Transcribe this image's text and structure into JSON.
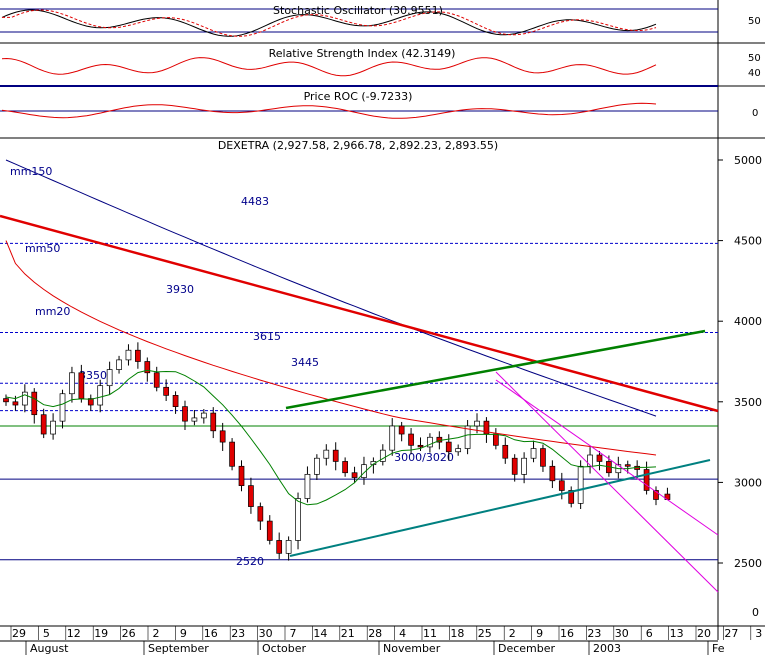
{
  "chart_data": {
    "type": "candlestick",
    "title": "DEXETRA (2,927.58, 2,966.78, 2,892.23, 2,893.55)",
    "colors": {
      "bull": "#ffffff",
      "bear": "#e00000",
      "mm20": "#008000",
      "mm50": "#e00000",
      "mm150": "#000080",
      "levels": "#0000cc",
      "downtrend": "#e00000",
      "uptrend": "#008000",
      "support": "#008080",
      "channel": "#e000e0"
    },
    "panels": [
      {
        "id": "stochastic",
        "label": "Stochastic Oscillator (30.9551)",
        "yticks": [
          "50"
        ],
        "ylim": [
          0,
          100
        ]
      },
      {
        "id": "rsi",
        "label": "Relative Strength Index (42.3149)",
        "yticks": [
          "50",
          "40"
        ],
        "ylim": [
          25,
          75
        ]
      },
      {
        "id": "roc",
        "label": "Price ROC (-9.7233)",
        "yticks": [
          "0"
        ],
        "ylim": [
          -30,
          30
        ]
      }
    ],
    "price_axis": {
      "ylim": [
        2450,
        5200
      ],
      "ticks": [
        "5000",
        "4500",
        "4000",
        "3500",
        "3000",
        "2500",
        "0"
      ],
      "grid": false
    },
    "x_ticks": [
      "29",
      "5",
      "12",
      "19",
      "26",
      "2",
      "9",
      "16",
      "23",
      "30",
      "7",
      "14",
      "21",
      "28",
      "4",
      "11",
      "18",
      "25",
      "2",
      "9",
      "16",
      "23",
      "30",
      "6",
      "13",
      "20",
      "27",
      "3"
    ],
    "months": [
      "August",
      "September",
      "October",
      "November",
      "December",
      "2003",
      "Fe"
    ],
    "levels": [
      {
        "label": "4483",
        "value": 4483,
        "style": "dashed"
      },
      {
        "label": "3930",
        "value": 3930,
        "style": "dashed"
      },
      {
        "label": "3615",
        "value": 3615,
        "style": "dashed"
      },
      {
        "label": "3445",
        "value": 3445,
        "style": "dashed"
      },
      {
        "label": "3350",
        "value": 3350,
        "style": "solid"
      },
      {
        "label": "3000/3020",
        "value": 3020,
        "style": "solid"
      },
      {
        "label": "2520",
        "value": 2520,
        "style": "solid"
      }
    ],
    "ma_labels": [
      "mm150",
      "mm50",
      "mm20"
    ],
    "last_candle": {
      "open": 2927.58,
      "high": 2966.78,
      "low": 2892.23,
      "close": 2893.55
    },
    "candles_approx_close": [
      3500,
      3480,
      3560,
      3420,
      3300,
      3380,
      3550,
      3680,
      3520,
      3480,
      3600,
      3700,
      3760,
      3820,
      3750,
      3680,
      3590,
      3540,
      3470,
      3380,
      3400,
      3430,
      3320,
      3250,
      3100,
      2980,
      2850,
      2760,
      2640,
      2560,
      2640,
      2900,
      3050,
      3150,
      3200,
      3130,
      3060,
      3030,
      3110,
      3130,
      3200,
      3350,
      3300,
      3230,
      3220,
      3280,
      3250,
      3190,
      3210,
      3350,
      3380,
      3300,
      3230,
      3150,
      3050,
      3150,
      3210,
      3100,
      3010,
      2950,
      2870,
      3100,
      3170,
      3130,
      3060,
      3110,
      3100,
      3080,
      2950,
      2894
    ]
  }
}
